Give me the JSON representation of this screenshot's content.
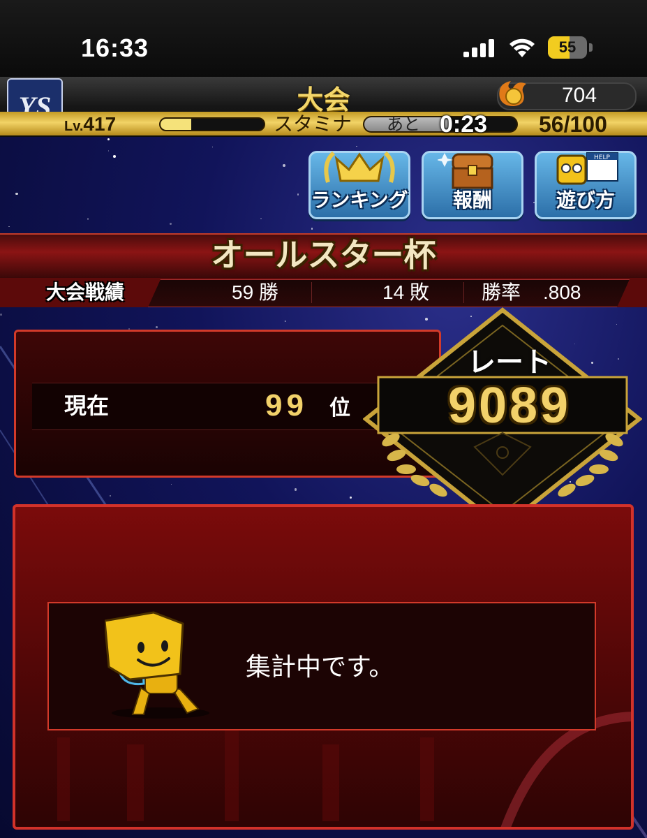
{
  "status_bar": {
    "time": "16:33",
    "battery": "55",
    "battery_level": 0.55
  },
  "header": {
    "title": "大会",
    "team_logo": "YS",
    "coins": "704",
    "level_prefix": "Lv.",
    "level": "417",
    "exp_level": 0.3,
    "stamina_label": "スタミナ",
    "stamina_remaining_label": "あと",
    "stamina_timer": "0:23",
    "stamina_value": "56/100",
    "stamina_level": 0.56
  },
  "menu": [
    {
      "label": "ランキング",
      "icon": "crown-icon"
    },
    {
      "label": "報酬",
      "icon": "treasure-chest-icon"
    },
    {
      "label": "遊び方",
      "icon": "help-mascot-icon",
      "badge": "HELP"
    }
  ],
  "tournament": {
    "name": "オールスター杯",
    "record_label": "大会戦績",
    "wins": "59 勝",
    "losses": "14 敗",
    "win_rate_label": "勝率",
    "win_rate": ".808"
  },
  "rank": {
    "label": "現在",
    "position": "99",
    "unit": "位"
  },
  "rate": {
    "label": "レート",
    "value": "9089"
  },
  "message": {
    "text": "集計中です。"
  },
  "colors": {
    "gold": "#f2d16a",
    "red_frame": "#d2322a",
    "menu_blue": "#3a86c4"
  }
}
